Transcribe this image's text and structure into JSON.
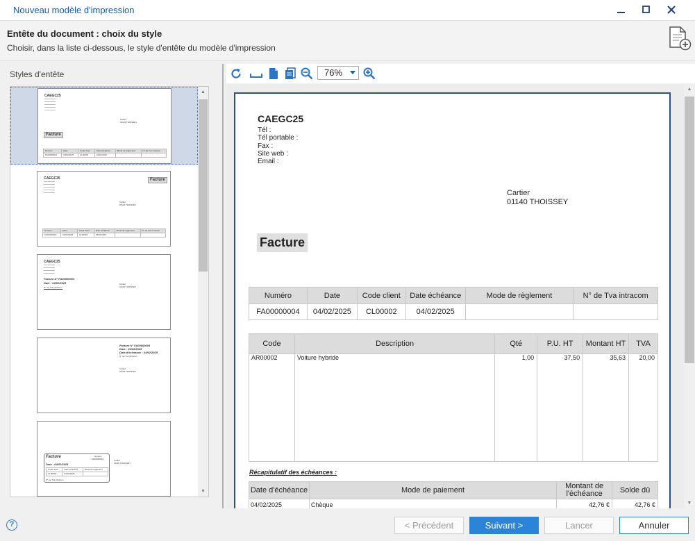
{
  "window": {
    "title": "Nouveau modèle d'impression"
  },
  "header": {
    "title": "Entête du document : choix du style",
    "subtitle": "Choisir, dans la liste ci-dessous, le style d'entête du modèle d'impression"
  },
  "styles": {
    "label": "Styles d'entête"
  },
  "toolbar": {
    "zoom": "76%"
  },
  "document": {
    "company": "CAEGC25",
    "contact_lines": [
      "Tél :",
      "Tél portable :",
      "Fax :",
      "Site web :",
      "Email :"
    ],
    "customer_name": "Cartier",
    "customer_city": "01140 THOISSEY",
    "doc_type": "Facture",
    "info_headers": [
      "Numéro",
      "Date",
      "Code client",
      "Date échéance",
      "Mode de règlement",
      "N° de Tva intracom"
    ],
    "info_values": [
      "FA00000004",
      "04/02/2025",
      "CL00002",
      "04/02/2025",
      "",
      ""
    ],
    "line_headers": [
      "Code",
      "Description",
      "Qté",
      "P.U. HT",
      "Montant HT",
      "TVA"
    ],
    "line_values": [
      "AR00002",
      "Voiture hybride",
      "1,00",
      "37,50",
      "35,63",
      "20,00"
    ],
    "recap_title": "Récapitulatif des échéances :",
    "recap_headers": [
      "Date d'échéance",
      "Mode de paiement",
      "Montant de l'échéance",
      "Solde dû"
    ],
    "recap_values": [
      "04/02/2025",
      "Chèque",
      "42,76 €",
      "42,76 €"
    ]
  },
  "thumbs": {
    "company": "CAEGC25",
    "doc_type": "Facture",
    "invoice_line": "Facture N° FA00000004",
    "date_line": "Date : 04/02/2025",
    "due_line": "Date d'échéance : 04/02/2025",
    "tva_line": "N° de Tva intracom :",
    "customer": "Cartier",
    "city": "01140 THOISSEY",
    "numero_label": "Numéro",
    "numero_value": "FA00000004",
    "mini_headers": [
      "Numéro",
      "Date",
      "Code client",
      "Date échéance",
      "Mode de règlement",
      "N° de Tva intracom"
    ],
    "mini_values": [
      "FA00000004",
      "04/02/2025",
      "CL00002",
      "04/02/2025",
      "",
      ""
    ],
    "mini_headers_alt": [
      "Code client",
      "Date échéance",
      "Mode de règlement"
    ],
    "mini_values_alt": [
      "CL00002",
      "04/02/2025",
      ""
    ]
  },
  "footer": {
    "help": "?",
    "previous": "< Précédent",
    "next": "Suivant >",
    "launch": "Lancer",
    "cancel": "Annuler"
  }
}
